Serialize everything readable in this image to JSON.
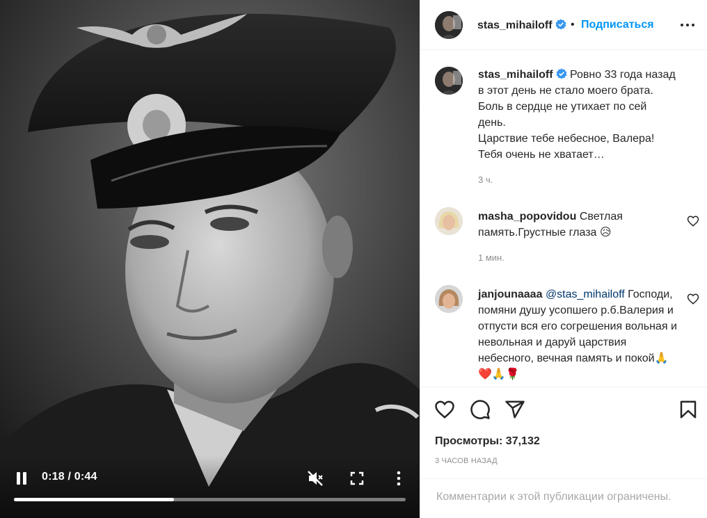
{
  "player": {
    "time_display": "0:18 / 0:44",
    "progress_fraction": 0.409
  },
  "post": {
    "author": "stas_mihailoff",
    "dot": "•",
    "follow_label": "Подписаться",
    "caption_lines": [
      "Ровно 33 года назад",
      "в этот день не стало моего брата.",
      "Боль в сердце не утихает по сей",
      "день.",
      "Царствие тебе небесное, Валера!",
      "Тебя очень не хватает…"
    ],
    "caption_time": "3 ч."
  },
  "comments": [
    {
      "username": "masha_popovidou",
      "text": "Светлая память.Грустные глаза 😥",
      "time": "1 мин."
    },
    {
      "username": "janjounaaaa",
      "mention": "@stas_mihailoff",
      "text": "Господи, помяни душу усопшего р.б.Валерия и отпусти вся его согрешения вольная и невольная и даруй царствия небесного, вечная память и покой🙏❤️🙏🌹"
    }
  ],
  "stats": {
    "views_label": "Просмотры:",
    "views_count": "37,132",
    "posted_ago": "3 ЧАСОВ НАЗАД"
  },
  "comments_limited": "Комментарии к этой публикации ограничены.",
  "colors": {
    "accent": "#0095f6",
    "verified": "#3897f0",
    "muted_text": "#8e8e8e",
    "heart_red": "#ed4956"
  },
  "icons": [
    "pause-icon",
    "volume-muted-icon",
    "fullscreen-icon",
    "more-vertical-icon",
    "verified-badge-icon",
    "more-horizontal-icon",
    "heart-icon",
    "comment-icon",
    "share-icon",
    "bookmark-icon"
  ]
}
